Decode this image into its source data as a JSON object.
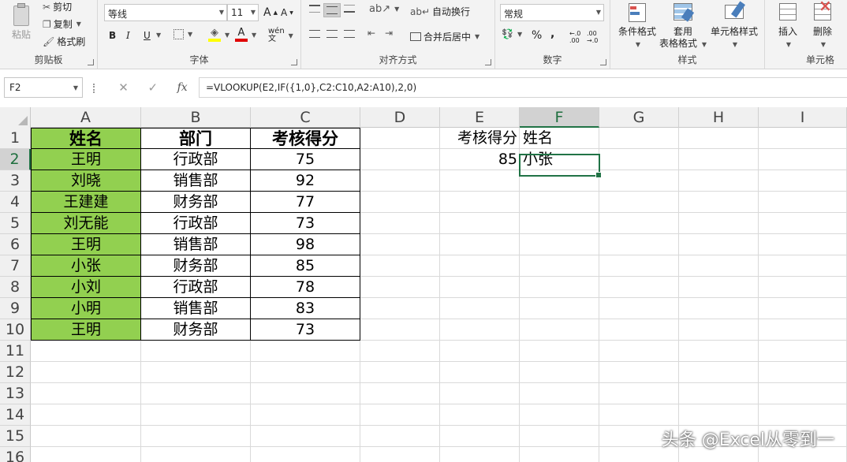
{
  "ribbon": {
    "clipboard": {
      "paste": "粘贴",
      "cut": "剪切",
      "copy": "复制",
      "format_painter": "格式刷",
      "label": "剪贴板"
    },
    "font": {
      "name": "等线",
      "size": "11",
      "bold": "B",
      "italic": "I",
      "underline": "U",
      "label": "字体"
    },
    "alignment": {
      "wrap_text": "自动换行",
      "merge_center": "合并后居中",
      "label": "对齐方式"
    },
    "number": {
      "format": "常规",
      "percent": "%",
      "comma": ",",
      "label": "数字"
    },
    "styles": {
      "conditional": "条件格式",
      "table_format_1": "套用",
      "table_format_2": "表格格式",
      "cell_styles": "单元格样式",
      "label": "样式"
    },
    "cells": {
      "insert": "插入",
      "delete": "删除",
      "label": "单元格"
    }
  },
  "formula_bar": {
    "name_box": "F2",
    "formula": "=VLOOKUP(E2,IF({1,0},C2:C10,A2:A10),2,0)"
  },
  "sheet": {
    "columns": [
      "A",
      "B",
      "C",
      "D",
      "E",
      "F",
      "G",
      "H",
      "I"
    ],
    "rows": [
      "1",
      "2",
      "3",
      "4",
      "5",
      "6",
      "7",
      "8",
      "9",
      "10",
      "11",
      "12",
      "13",
      "14",
      "15",
      "16"
    ],
    "selected_column": "F",
    "selected_row": "2",
    "table": {
      "headers": [
        "姓名",
        "部门",
        "考核得分"
      ],
      "rows": [
        [
          "王明",
          "行政部",
          "75"
        ],
        [
          "刘晓",
          "销售部",
          "92"
        ],
        [
          "王建建",
          "财务部",
          "77"
        ],
        [
          "刘无能",
          "行政部",
          "73"
        ],
        [
          "王明",
          "销售部",
          "98"
        ],
        [
          "小张",
          "财务部",
          "85"
        ],
        [
          "小刘",
          "行政部",
          "78"
        ],
        [
          "小明",
          "销售部",
          "83"
        ],
        [
          "王明",
          "财务部",
          "73"
        ]
      ]
    },
    "lookup": {
      "e1": "考核得分",
      "f1": "姓名",
      "e2": "85",
      "f2": "小张"
    },
    "accent": "#217346",
    "highlight": "#92d050"
  },
  "watermark": "头条 @Excel从零到一"
}
